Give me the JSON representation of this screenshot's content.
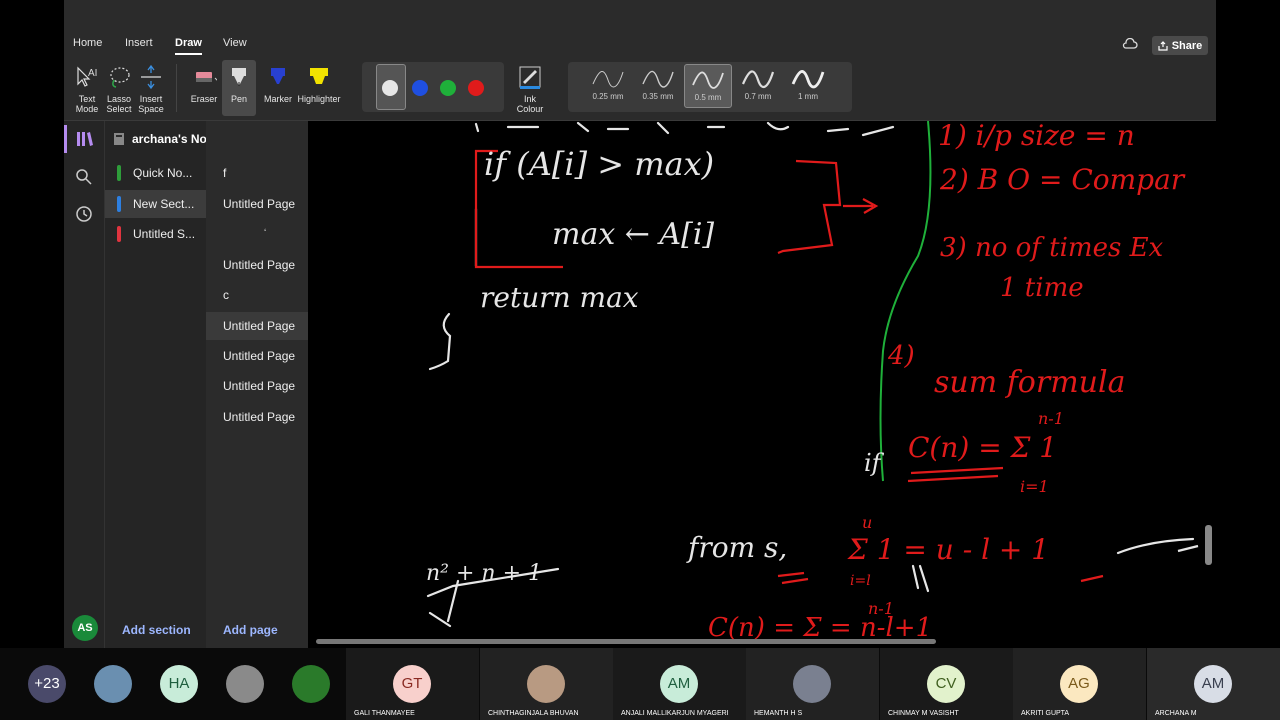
{
  "menu": {
    "tabs": [
      "Home",
      "Insert",
      "Draw",
      "View"
    ],
    "active": "Draw",
    "share_label": "Share"
  },
  "ribbon": {
    "tools": [
      {
        "line1": "Text",
        "line2": "Mode"
      },
      {
        "line1": "Lasso",
        "line2": "Select"
      },
      {
        "line1": "Insert",
        "line2": "Space"
      }
    ],
    "eraser": "Eraser",
    "pen": "Pen",
    "marker": "Marker",
    "highlighter": "Highlighter",
    "colors": [
      "#e6e6e6",
      "#1f4fe0",
      "#1fb03a",
      "#e01b1b"
    ],
    "ink_colour": {
      "line1": "Ink",
      "line2": "Colour"
    },
    "thickness": [
      "0.25 mm",
      "0.35 mm",
      "0.5 mm",
      "0.7 mm",
      "1 mm"
    ],
    "selected_thickness": "0.5 mm"
  },
  "notebook": {
    "title": "archana's Notebo..."
  },
  "sections": [
    {
      "label": "Quick No...",
      "color": "#2e9d3a"
    },
    {
      "label": "New Sect...",
      "color": "#2d7fe0"
    },
    {
      "label": "Untitled S...",
      "color": "#e0343f"
    }
  ],
  "pages": [
    "f",
    "Untitled Page",
    "",
    "Untitled Page",
    "c",
    "Untitled Page",
    "Untitled Page",
    "Untitled Page",
    "Untitled Page"
  ],
  "add_section": "Add section",
  "add_page": "Add page",
  "user_initials": "AS",
  "ink_text": {
    "w1": "if (A[i] > max)",
    "w2": "max ← A[i]",
    "w3": "return max",
    "w4": "n² + n + 1",
    "w5": "from s,",
    "r1": "1) i/p size = n",
    "r2": "2) B O = Compar",
    "r3": "3) no of times Ex",
    "r4": "1 time",
    "r5": "4)",
    "r6": "sum formula",
    "r7": "C(n) = Σ 1",
    "r8": "Σ 1 = u - l + 1",
    "r9": "n-1",
    "r10": "i=1",
    "r11": "u",
    "r12": "i=l",
    "r13": "C(n) = Σ = n-l+1",
    "r14": "n-1",
    "r15": "if"
  },
  "participants": [
    {
      "initials": "+23",
      "name": "",
      "bg": "#4a4a6a",
      "fg": "#ffffff"
    },
    {
      "initials": "",
      "name": "",
      "bg": "#6a8fb0",
      "fg": "#ffffff"
    },
    {
      "initials": "HA",
      "name": "",
      "bg": "#c8ecd9",
      "fg": "#1f5f3f"
    },
    {
      "initials": "",
      "name": "",
      "bg": "#8a8a8a",
      "fg": "#ffffff"
    },
    {
      "initials": "",
      "name": "",
      "bg": "#2a7a2a",
      "fg": "#ffffff"
    },
    {
      "initials": "GT",
      "name": "GALI THANMAYEE",
      "bg": "#f8d0cc",
      "fg": "#8a2a22"
    },
    {
      "initials": "",
      "name": "CHINTHAGINJALA BHUVAN",
      "bg": "#b89a82",
      "fg": "#ffffff"
    },
    {
      "initials": "AM",
      "name": "ANJALI MALLIKARJUN MYAGERI",
      "bg": "#c8ecd9",
      "fg": "#1f5f3f"
    },
    {
      "initials": "",
      "name": "HEMANTH H S",
      "bg": "#7a8090",
      "fg": "#ffffff"
    },
    {
      "initials": "CV",
      "name": "CHINMAY M VASISHT",
      "bg": "#e2f2cc",
      "fg": "#3f5f1f"
    },
    {
      "initials": "AG",
      "name": "AKRITI GUPTA",
      "bg": "#fbe8c0",
      "fg": "#7a5a1a"
    },
    {
      "initials": "AM",
      "name": "ARCHANA M",
      "bg": "#d8dde6",
      "fg": "#3a4050"
    }
  ]
}
